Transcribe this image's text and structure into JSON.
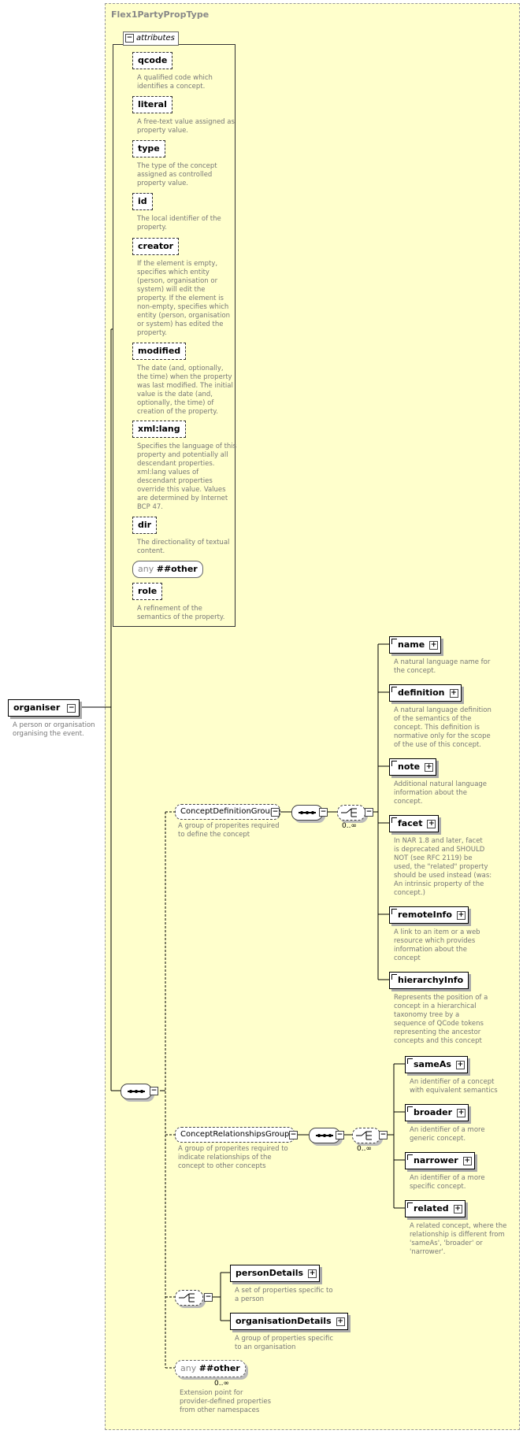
{
  "type_title": "Flex1PartyPropType",
  "attributes_header": "attributes",
  "attributes": [
    {
      "name": "qcode",
      "desc": [
        "A qualified code which",
        "identifies a concept."
      ]
    },
    {
      "name": "literal",
      "desc": [
        "A free-text value assigned as",
        "property value."
      ]
    },
    {
      "name": "type",
      "desc": [
        "The type of the concept",
        "assigned as controlled",
        "property value."
      ]
    },
    {
      "name": "id",
      "desc": [
        "The local identifier of the",
        "property."
      ]
    },
    {
      "name": "creator",
      "desc": [
        "If the element is empty,",
        "specifies which entity",
        "(person, organisation or",
        "system) will edit the",
        "property. If the element is",
        "non-empty, specifies which",
        "entity (person, organisation",
        "or system) has edited the",
        "property."
      ]
    },
    {
      "name": "modified",
      "desc": [
        "The date (and, optionally,",
        "the time) when the property",
        "was last modified. The initial",
        "value is the date (and,",
        "optionally, the time) of",
        "creation of the property."
      ]
    },
    {
      "name": "xml:lang",
      "desc": [
        "Specifies the language of this",
        "property and potentially all",
        "descendant properties.",
        "xml:lang values of",
        "descendant properties",
        "override this value. Values",
        "are determined by Internet",
        "BCP 47."
      ]
    },
    {
      "name": "dir",
      "desc": [
        "The directionality of textual",
        "content."
      ]
    },
    {
      "name": "role",
      "desc": [
        "A refinement of the",
        "semantics of the property."
      ]
    }
  ],
  "any_attr": {
    "keyword": "any",
    "value": "##other"
  },
  "root": {
    "name": "organiser",
    "desc": [
      "A person or organisation",
      "organising the event."
    ]
  },
  "concept_def_group": {
    "name": "ConceptDefinitionGroup",
    "desc": [
      "A group of properites required",
      "to define the concept"
    ],
    "occurrence": "0..∞"
  },
  "concept_def_items": [
    {
      "name": "name",
      "desc": [
        "A natural language name for",
        "the concept."
      ]
    },
    {
      "name": "definition",
      "desc": [
        "A natural language definition",
        "of the semantics of the",
        "concept. This definition is",
        "normative only for the scope",
        "of the use of this concept."
      ]
    },
    {
      "name": "note",
      "desc": [
        "Additional natural language",
        "information about the",
        "concept."
      ]
    },
    {
      "name": "facet",
      "desc": [
        "In NAR 1.8 and later, facet",
        "is deprecated and SHOULD",
        "NOT (see RFC 2119) be",
        "used, the \"related\" property",
        "should be used instead (was:",
        "An intrinsic property of the",
        "concept.)"
      ]
    },
    {
      "name": "remoteInfo",
      "desc": [
        "A link to an item or a web",
        "resource which provides",
        "information about the",
        "concept"
      ]
    },
    {
      "name": "hierarchyInfo",
      "desc": [
        "Represents the position of a",
        "concept in a hierarchical",
        "taxonomy tree by a",
        "sequence of QCode tokens",
        "representing the ancestor",
        "concepts and this concept"
      ]
    }
  ],
  "concept_rel_group": {
    "name": "ConceptRelationshipsGroup",
    "desc": [
      "A group of properites required to",
      "indicate relationships of the",
      "concept to other concepts"
    ],
    "occurrence": "0..∞"
  },
  "concept_rel_items": [
    {
      "name": "sameAs",
      "desc": [
        "An identifier of a concept",
        "with equivalent semantics"
      ]
    },
    {
      "name": "broader",
      "desc": [
        "An identifier of a more",
        "generic concept."
      ]
    },
    {
      "name": "narrower",
      "desc": [
        "An identifier of a more",
        "specific concept."
      ]
    },
    {
      "name": "related",
      "desc": [
        "A related concept, where the",
        "relationship is different from",
        "'sameAs', 'broader' or",
        "'narrower'."
      ]
    }
  ],
  "choice_items": [
    {
      "name": "personDetails",
      "desc": [
        "A set of properties specific to",
        "a person"
      ]
    },
    {
      "name": "organisationDetails",
      "desc": [
        "A group of properties specific",
        "to an organisation"
      ]
    }
  ],
  "any_element": {
    "keyword": "any",
    "value": "##other",
    "occurrence": "0..∞",
    "desc": [
      "Extension point for",
      "provider-defined properties",
      "from other namespaces"
    ]
  }
}
